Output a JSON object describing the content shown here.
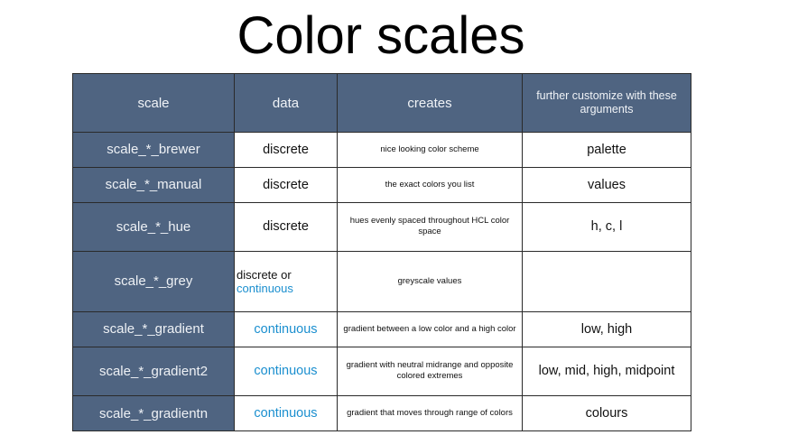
{
  "title": "Color scales",
  "headers": {
    "scale": "scale",
    "data": "data",
    "creates": "creates",
    "args": "further customize with these arguments"
  },
  "rows": [
    {
      "scale": "scale_*_brewer",
      "data": "discrete",
      "creates": "nice looking color scheme",
      "args": "palette"
    },
    {
      "scale": "scale_*_manual",
      "data": "discrete",
      "creates": "the exact colors you list",
      "args": "values"
    },
    {
      "scale": "scale_*_hue",
      "data": "discrete",
      "creates": "hues evenly spaced throughout HCL color space",
      "args": "h, c, l"
    },
    {
      "scale": "scale_*_grey",
      "data_a": "discrete or",
      "data_b": "continuous",
      "creates": "greyscale values",
      "args": ""
    },
    {
      "scale": "scale_*_gradient",
      "data": "continuous",
      "creates": "gradient between a low color and a high color",
      "args": "low, high"
    },
    {
      "scale": "scale_*_gradient2",
      "data": "continuous",
      "creates": "gradient with neutral midrange and opposite colored extremes",
      "args": "low, mid, high, midpoint"
    },
    {
      "scale": "scale_*_gradientn",
      "data": "continuous",
      "creates": "gradient that moves through range of colors",
      "args": "colours"
    }
  ],
  "colors": {
    "header_fill": "#4f6481",
    "continuous_text": "#1b8fcf"
  }
}
